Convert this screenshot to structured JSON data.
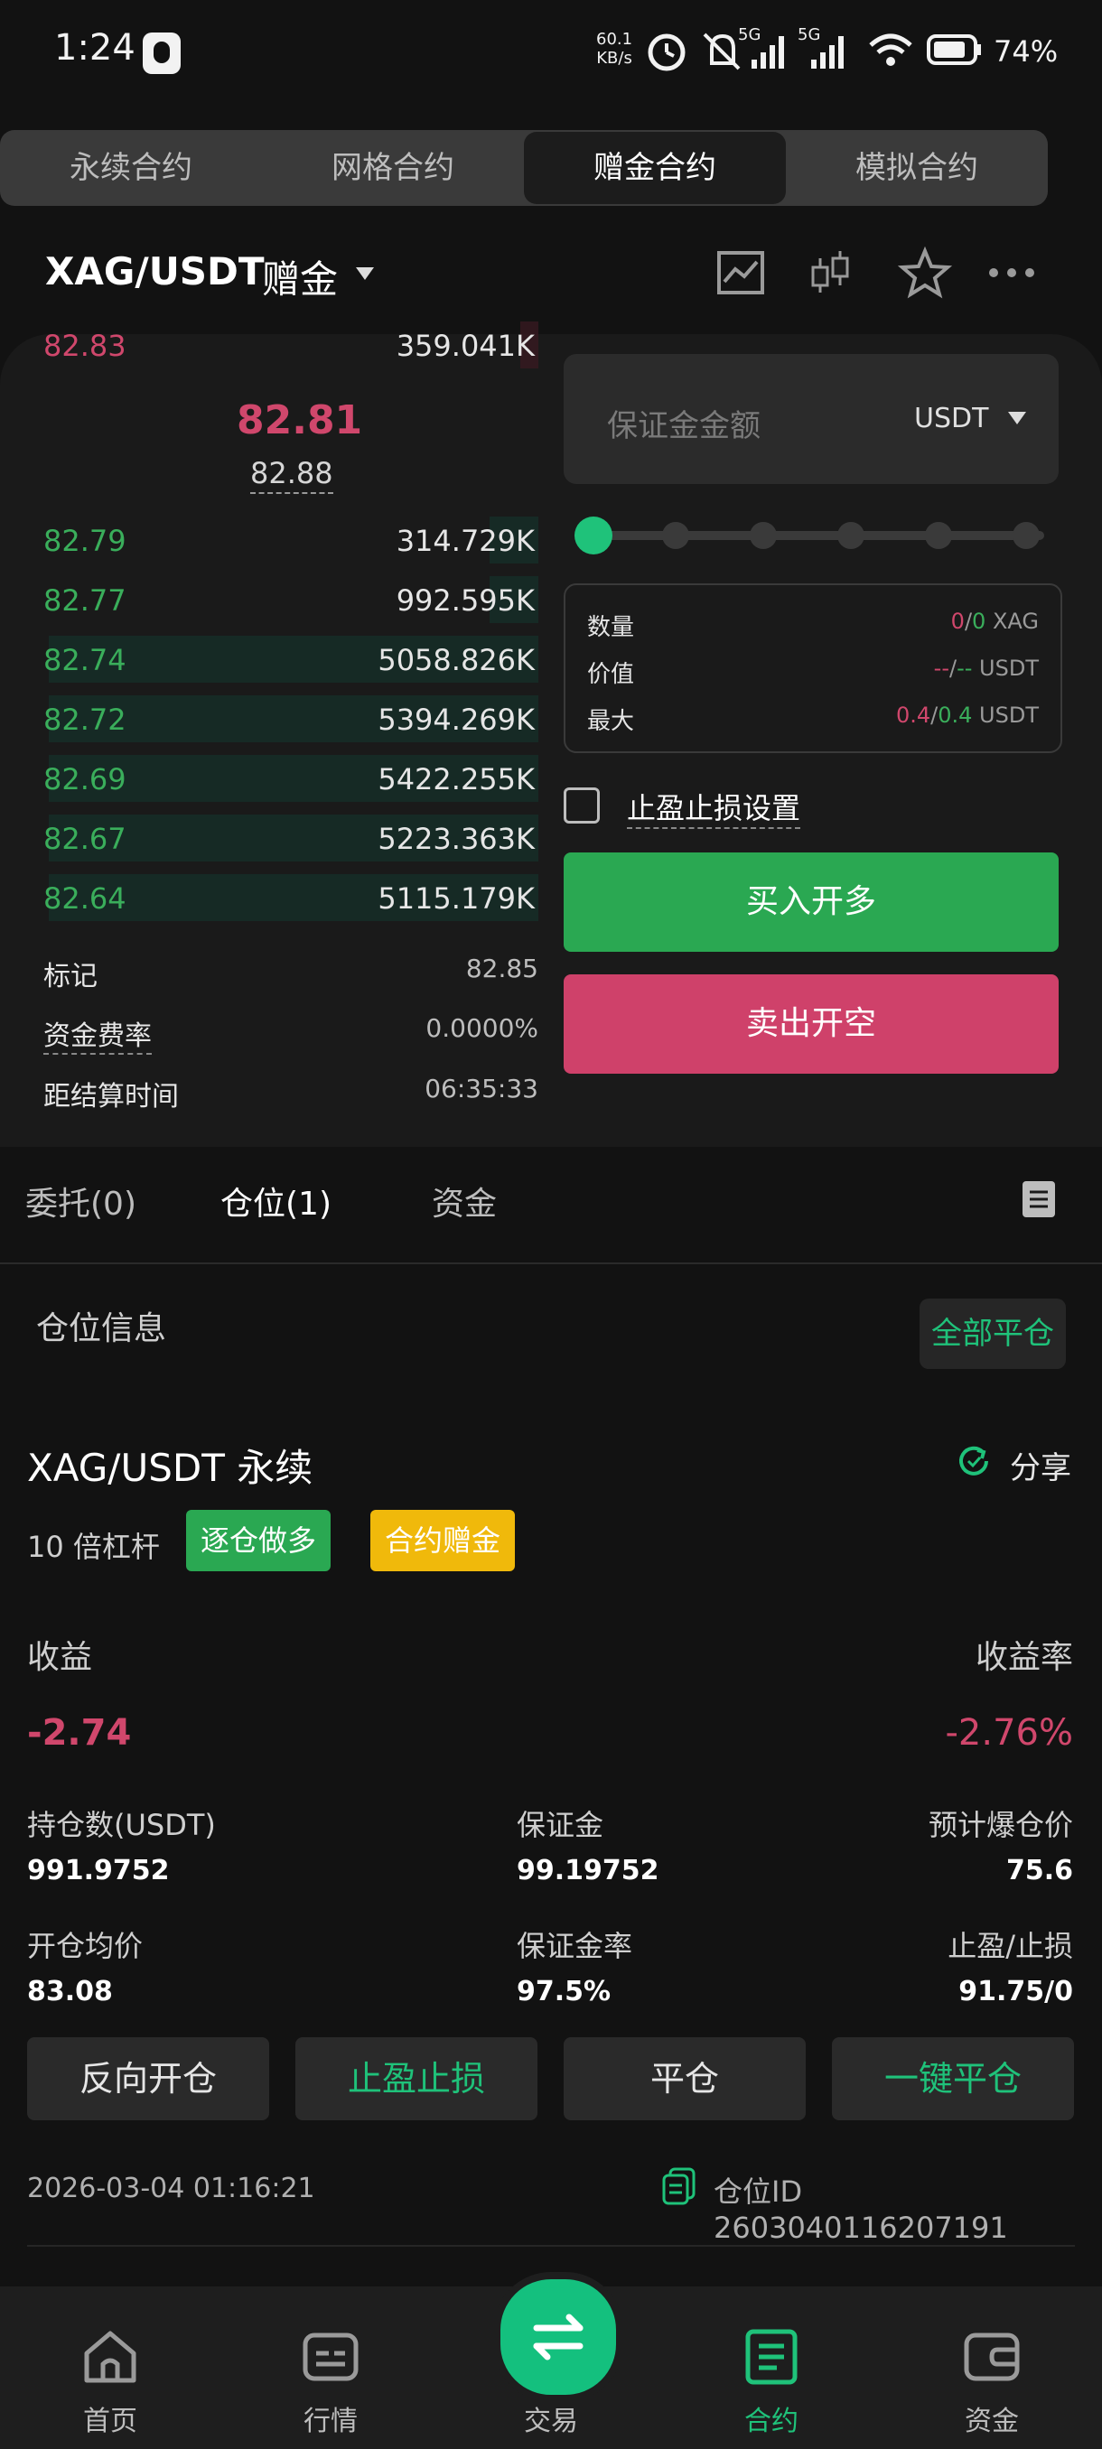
{
  "status_bar": {
    "time": "1:24",
    "net_speed_value": "60.1",
    "net_speed_unit": "KB/s",
    "network1": "5G",
    "network2": "5G",
    "battery": "74%"
  },
  "tabs": [
    "永续合约",
    "网格合约",
    "赠金合约",
    "模拟合约"
  ],
  "pair": {
    "symbol": "XAG/USDT",
    "tag": "赠金"
  },
  "orderbook": {
    "ask_top": {
      "price": "82.83",
      "qty": "359.041K"
    },
    "last_price": "82.81",
    "mark_price": "82.88",
    "bids": [
      {
        "price": "82.79",
        "qty": "314.729K",
        "depth": 0.09
      },
      {
        "price": "82.77",
        "qty": "992.595K",
        "depth": 0.09
      },
      {
        "price": "82.74",
        "qty": "5058.826K",
        "depth": 0.91
      },
      {
        "price": "82.72",
        "qty": "5394.269K",
        "depth": 0.91
      },
      {
        "price": "82.69",
        "qty": "5422.255K",
        "depth": 0.91
      },
      {
        "price": "82.67",
        "qty": "5223.363K",
        "depth": 0.91
      },
      {
        "price": "82.64",
        "qty": "5115.179K",
        "depth": 0.91
      }
    ]
  },
  "market_info": [
    {
      "label": "标记",
      "value": "82.85"
    },
    {
      "label": "资金费率",
      "value": "0.0000%"
    },
    {
      "label": "距结算时间",
      "value": "06:35:33"
    }
  ],
  "order_form": {
    "margin_placeholder": "保证金金额",
    "currency": "USDT",
    "slider_steps": 6,
    "info": {
      "qty_label": "数量",
      "qty_left": "0",
      "qty_right": "0",
      "qty_unit": "XAG",
      "value_label": "价值",
      "value_left": "--",
      "value_right": "--",
      "value_unit": "USDT",
      "max_label": "最大",
      "max_left": "0.4",
      "max_right": "0.4",
      "max_unit": "USDT"
    },
    "tpsl_label": "止盈止损设置",
    "buy_label": "买入开多",
    "sell_label": "卖出开空"
  },
  "lower_tabs": {
    "orders": "委托(0)",
    "positions": "仓位(1)",
    "funds": "资金"
  },
  "position": {
    "section_title": "仓位信息",
    "close_all": "全部平仓",
    "symbol": "XAG/USDT 永续",
    "share": "分享",
    "leverage": "10 倍杠杆",
    "badge_mode": "逐仓做多",
    "badge_bonus": "合约赠金",
    "pnl_label": "收益",
    "roe_label": "收益率",
    "pnl": "-2.74",
    "roe": "-2.76%",
    "size_label": "持仓数(USDT)",
    "size": "991.9752",
    "margin_label": "保证金",
    "margin": "99.19752",
    "liq_label": "预计爆仓价",
    "liq": "75.6",
    "entry_label": "开仓均价",
    "entry": "83.08",
    "margin_rate_label": "保证金率",
    "margin_rate": "97.5%",
    "tpsl_label": "止盈/止损",
    "tpsl": "91.75/0",
    "actions": [
      "反向开仓",
      "止盈止损",
      "平仓",
      "一键平仓"
    ],
    "time": "2026-03-04 01:16:21",
    "id_text": "仓位ID 2603040116207191"
  },
  "nav": [
    {
      "label": "首页",
      "icon": "home-icon"
    },
    {
      "label": "行情",
      "icon": "market-icon"
    },
    {
      "label": "交易",
      "icon": "swap-icon"
    },
    {
      "label": "合约",
      "icon": "contract-icon"
    },
    {
      "label": "资金",
      "icon": "wallet-icon"
    }
  ],
  "colors": {
    "green": "#3aae5b",
    "red": "#d0476c",
    "accent": "#1fc27a",
    "buy_button": "#2aa852",
    "sell_button": "#cf416a",
    "badge_mode": "#2aa852",
    "badge_bonus": "#f0b90b"
  }
}
